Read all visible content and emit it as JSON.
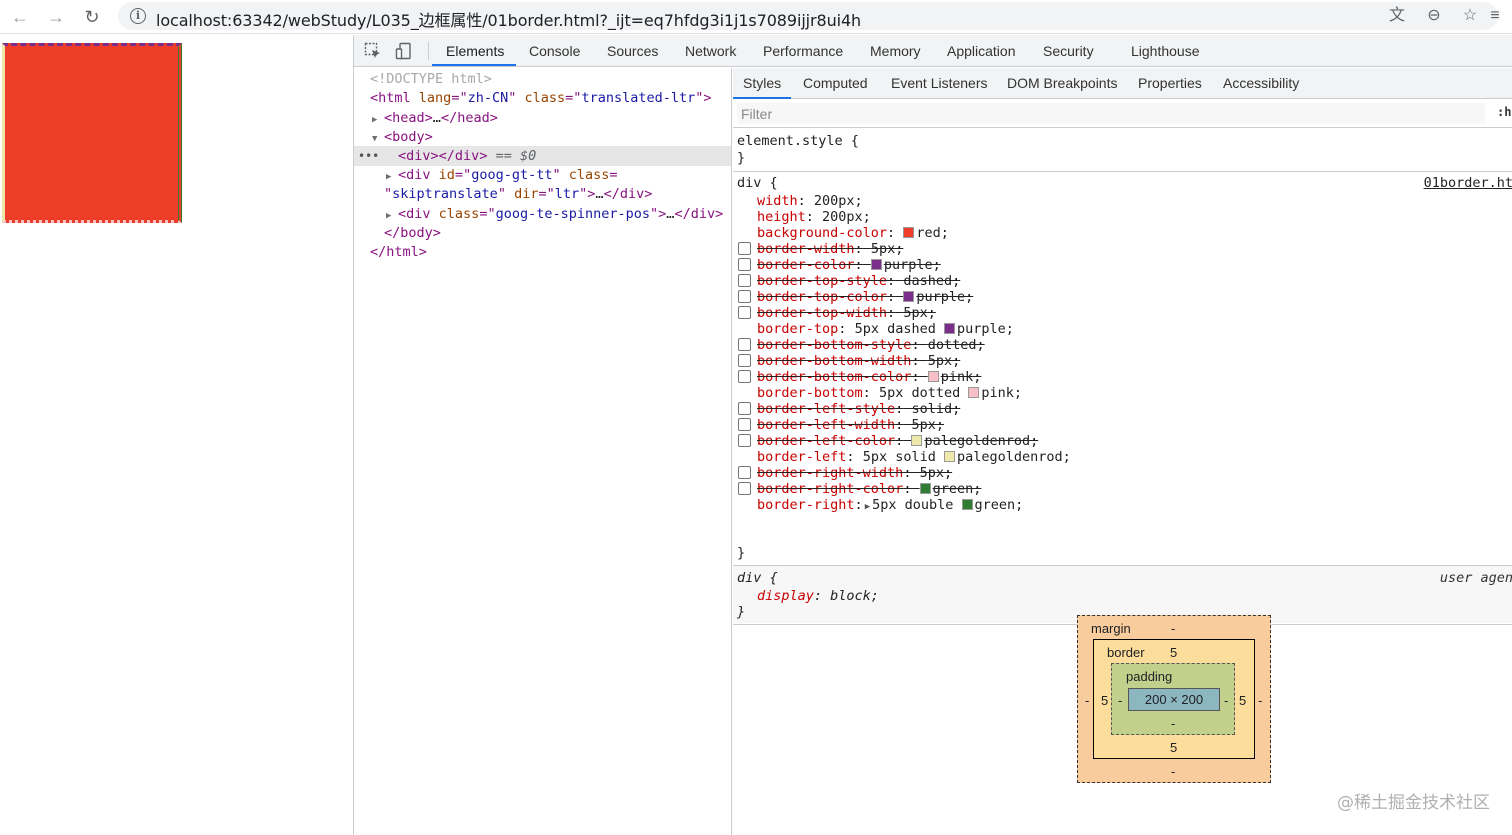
{
  "browser": {
    "url": "localhost:63342/webStudy/L035_边框属性/01border.html?_ijt=eq7hfdg3i1j1s7089ijjr8ui4h",
    "back_icon": "←",
    "forward_icon": "→",
    "reload_icon": "↻",
    "info_icon": "i",
    "translate_icon": "文",
    "zoom_icon": "⊖",
    "star_icon": "☆",
    "menu_icon": "≡"
  },
  "devtools": {
    "tabs": [
      "Elements",
      "Console",
      "Sources",
      "Network",
      "Performance",
      "Memory",
      "Application",
      "Security",
      "Lighthouse"
    ],
    "active_tab": "Elements",
    "dom": {
      "doctype": "<!DOCTYPE html>",
      "html_tag": "html",
      "html_lang_attr": "lang",
      "html_lang_val": "zh-CN",
      "html_class_attr": "class",
      "html_class_val": "translated-ltr",
      "head": "head",
      "head_ellipsis": "…",
      "body": "body",
      "selected_div": "div",
      "selected_suffix": "== $0",
      "div2_tag": "div",
      "div2_id_attr": "id",
      "div2_id_val": "goog-gt-tt",
      "div2_class_attr": "class",
      "div2_class_val": "skiptranslate",
      "div2_dir_attr": "dir",
      "div2_dir_val": "ltr",
      "div3_tag": "div",
      "div3_class_attr": "class",
      "div3_class_val": "goog-te-spinner-pos",
      "ellipsis": "…",
      "dots": "•••"
    },
    "sub_tabs": [
      "Styles",
      "Computed",
      "Event Listeners",
      "DOM Breakpoints",
      "Properties",
      "Accessibility"
    ],
    "filter_placeholder": "Filter",
    "hov_label": ":h",
    "element_style": "element.style {",
    "close_brace": "}",
    "div_rule": {
      "selector": "div {",
      "source": "01border.ht",
      "active_props": [
        {
          "name": "width",
          "value": "200px;"
        },
        {
          "name": "height",
          "value": "200px;"
        },
        {
          "name": "background-color",
          "value": "red;",
          "swatch": "#ee3e2a"
        }
      ],
      "props": [
        {
          "name": "border-width",
          "value": "5px;",
          "overridden": true
        },
        {
          "name": "border-color",
          "value": "purple;",
          "swatch": "#7b2e8c",
          "overridden": true
        },
        {
          "name": "border-top-style",
          "value": "dashed;",
          "overridden": true
        },
        {
          "name": "border-top-color",
          "value": "purple;",
          "swatch": "#7b2e8c",
          "overridden": true
        },
        {
          "name": "border-top-width",
          "value": "5px;",
          "overridden": true
        },
        {
          "name": "border-top",
          "value": "5px dashed",
          "value2": "purple;",
          "swatch": "#7b2e8c",
          "overridden": false
        },
        {
          "name": "border-bottom-style",
          "value": "dotted;",
          "overridden": true
        },
        {
          "name": "border-bottom-width",
          "value": "5px;",
          "overridden": true
        },
        {
          "name": "border-bottom-color",
          "value": "pink;",
          "swatch": "#f6c0c6",
          "overridden": true
        },
        {
          "name": "border-bottom",
          "value": "5px dotted",
          "value2": "pink;",
          "swatch": "#f6c0c6",
          "overridden": false
        },
        {
          "name": "border-left-style",
          "value": "solid;",
          "overridden": true
        },
        {
          "name": "border-left-width",
          "value": "5px;",
          "overridden": true
        },
        {
          "name": "border-left-color",
          "value": "palegoldenrod;",
          "swatch": "#eee8aa",
          "overridden": true
        },
        {
          "name": "border-left",
          "value": "5px solid",
          "value2": "palegoldenrod;",
          "swatch": "#eee8aa",
          "overridden": false
        },
        {
          "name": "border-right-width",
          "value": "5px;",
          "overridden": true
        },
        {
          "name": "border-right-color",
          "value": "green;",
          "swatch": "#2e7d32",
          "overridden": true
        },
        {
          "name": "border-right",
          "value": "5px double",
          "value2": "green;",
          "swatch": "#2e7d32",
          "overridden": false,
          "expand": true
        }
      ]
    },
    "ua_rule": {
      "selector": "div {",
      "source": "user agen",
      "prop": "display",
      "value": "block;"
    },
    "box_model": {
      "margin_label": "margin",
      "margin_val": "-",
      "border_label": "border",
      "border_val": "5",
      "padding_label": "padding",
      "content": "200 × 200",
      "left_margin": "-",
      "left_border": "5",
      "left_padding": "-",
      "right_padding": "-",
      "right_border": "5",
      "right_margin": "-",
      "bottom_padding": "-",
      "bottom_border": "5",
      "bottom_margin": "-"
    }
  },
  "watermark": "@稀土掘金技术社区",
  "colors": {
    "box_bg": "#ee3e2a",
    "accent": "#1a73e8"
  }
}
